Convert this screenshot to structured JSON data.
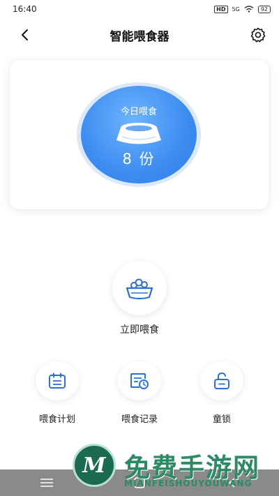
{
  "status_bar": {
    "time": "16:40",
    "hd": "HD",
    "signal": "5G",
    "battery": "92"
  },
  "header": {
    "title": "智能喂食器",
    "back_icon": "chevron-left-icon",
    "settings_icon": "gear-icon"
  },
  "today": {
    "label": "今日喂食",
    "count": "8 份",
    "icon": "pet-bowl-icon"
  },
  "feed_now": {
    "label": "立即喂食",
    "icon": "food-bowl-icon"
  },
  "actions": [
    {
      "label": "喂食计划",
      "icon": "calendar-icon"
    },
    {
      "label": "喂食记录",
      "icon": "record-clock-icon"
    },
    {
      "label": "童锁",
      "icon": "lock-icon"
    }
  ],
  "watermark": {
    "logo": "M",
    "title": "免费手游网",
    "subtitle": "MIANFEISHOUYOUWANG"
  },
  "colors": {
    "accent": "#3d8cf0",
    "icon_blue": "#2f6fd6",
    "watermark_green": "#2c8a64"
  }
}
